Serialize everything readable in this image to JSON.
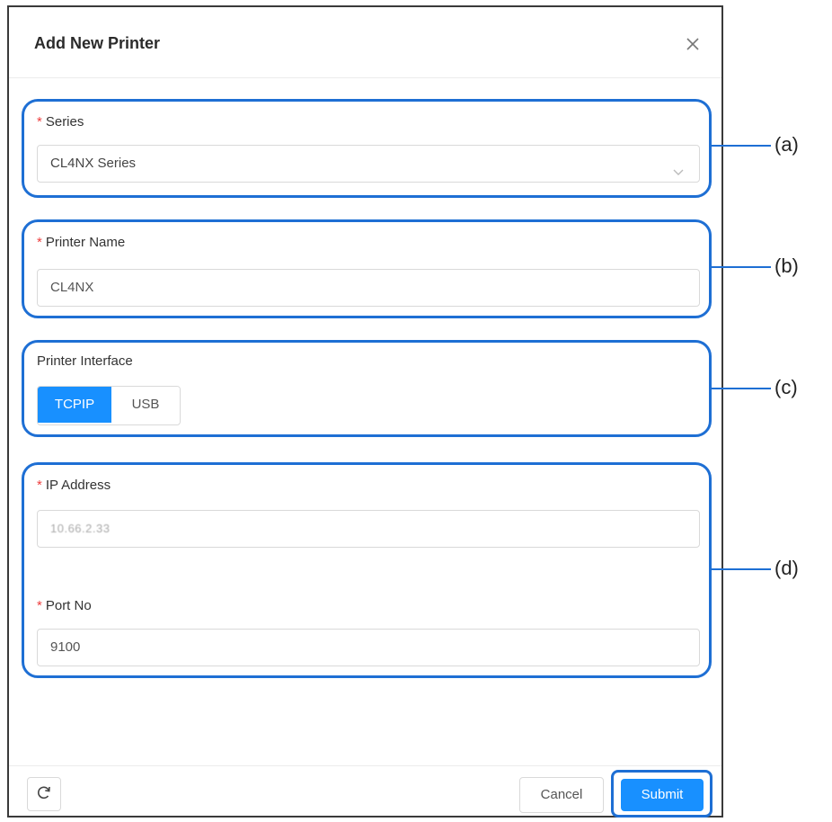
{
  "dialog": {
    "title": "Add New Printer",
    "close_icon": "close-icon"
  },
  "series": {
    "label": "Series",
    "required_mark": "*",
    "value": "CL4NX Series",
    "icon": "chevron-down-icon"
  },
  "printer_name": {
    "label": "Printer Name",
    "required_mark": "*",
    "value": "CL4NX"
  },
  "printer_interface": {
    "label": "Printer Interface",
    "options": [
      "TCPIP",
      "USB"
    ],
    "selected": "TCPIP"
  },
  "ip_address": {
    "label": "IP Address",
    "required_mark": "*",
    "value": "10.66.2.33"
  },
  "port_no": {
    "label": "Port No",
    "required_mark": "*",
    "value": "9100"
  },
  "footer": {
    "refresh_icon": "refresh-icon",
    "cancel_label": "Cancel",
    "submit_label": "Submit"
  },
  "callouts": [
    "(a)",
    "(b)",
    "(c)",
    "(d)"
  ],
  "colors": {
    "primary": "#1890ff",
    "callout": "#1e6fd4",
    "required": "#ee4040"
  }
}
